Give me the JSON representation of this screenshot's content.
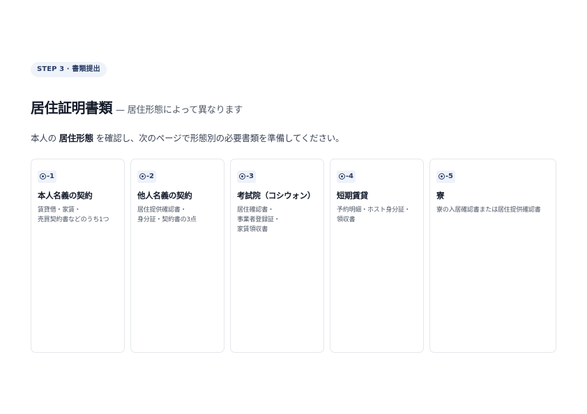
{
  "step_badge": "STEP 3 · 書類提出",
  "title": {
    "main": "居住証明書類",
    "sub": "— 居住形態によって異なります"
  },
  "intro": {
    "before": "本人の ",
    "emphasis": "居住形態",
    "after": " を確認し、次のページで形態別の必要書類を準備してください。"
  },
  "cards": [
    {
      "tag": "-1",
      "title": "本人名義の契約",
      "desc": [
        "賃貸借・家賃・",
        "売買契約書などのうち1つ"
      ]
    },
    {
      "tag": "-2",
      "title": "他人名義の契約",
      "desc": [
        "居住提供確認書・",
        "身分証・契約書の3点"
      ]
    },
    {
      "tag": "-3",
      "title": "考試院（コシウォン）",
      "desc": [
        "居住確認書・",
        "事業者登録証・",
        "家賃領収書"
      ]
    },
    {
      "tag": "-4",
      "title": "短期賃貸",
      "desc": [
        "予約明細・ホスト身分証・",
        "領収書"
      ]
    },
    {
      "tag": "-5",
      "title": "寮",
      "desc": [
        "寮の入居確認書または居住提供確認書"
      ]
    }
  ]
}
